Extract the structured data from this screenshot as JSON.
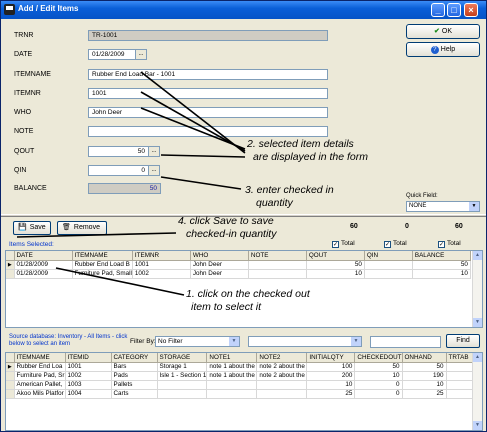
{
  "window": {
    "title": "Add / Edit Items"
  },
  "form": {
    "labels": {
      "trnr": "TRNR",
      "date": "DATE",
      "itemname": "ITEMNAME",
      "itemnr": "ITEMNR",
      "who": "WHO",
      "note": "NOTE",
      "qout": "QOUT",
      "qin": "QIN",
      "balance": "BALANCE"
    },
    "values": {
      "trnr": "TR-1001",
      "date": "01/28/2009",
      "itemname": "Rubber End Load Bar - 1001",
      "itemnr": "1001",
      "who": "John Deer",
      "note": "",
      "qout": "50",
      "qin": "0",
      "balance": "50"
    },
    "ellipsis": "..."
  },
  "buttons": {
    "ok": "OK",
    "help": "Help",
    "save": "Save",
    "remove": "Remove",
    "find": "Find"
  },
  "quick_field": {
    "label": "Quick Field:",
    "value": "NONE"
  },
  "totals": {
    "t1": "60",
    "t2": "0",
    "t3": "60",
    "check_label": "Total"
  },
  "items_selected_label": "Items Selected:",
  "top_grid": {
    "columns": [
      "DATE",
      "ITEMNAME",
      "ITEMNR",
      "WHO",
      "NOTE",
      "QOUT",
      "QIN",
      "BALANCE"
    ],
    "rows": [
      [
        "01/28/2009",
        "Rubber End Load B",
        "1001",
        "John Deer",
        "",
        "50",
        "",
        "50"
      ],
      [
        "01/28/2009",
        "Furniture Pad, Small",
        "1002",
        "John Deer",
        "",
        "10",
        "",
        "10"
      ]
    ]
  },
  "source": {
    "text": "Source database: Inventory - All Items - click below to select an item",
    "filter_label": "Filter By:",
    "filter_value": "No Filter",
    "filter2_value": ""
  },
  "bottom_grid": {
    "columns": [
      "ITEMNAME",
      "ITEMID",
      "CATEGORY",
      "STORAGE",
      "NOTE1",
      "NOTE2",
      "INITIALQTY",
      "CHECKEDOUT",
      "ONHAND",
      "TRTAB"
    ],
    "rows": [
      [
        "Rubber End Loa",
        "1001",
        "Bars",
        "Storage 1",
        "note 1 about the",
        "note 2 about the",
        "100",
        "50",
        "50",
        ""
      ],
      [
        "Furniture Pad, Sr",
        "1002",
        "Pads",
        "Isle 1 - Section 1",
        "note 1 about the",
        "note 2 about the",
        "200",
        "10",
        "190",
        ""
      ],
      [
        "American Pallet, ",
        "1003",
        "Pallets",
        "",
        "",
        "",
        "10",
        "0",
        "10",
        ""
      ],
      [
        "Akoo Mils Platfor",
        "1004",
        "Carts",
        "",
        "",
        "",
        "25",
        "0",
        "25",
        ""
      ]
    ]
  },
  "annotations": {
    "a1": "1. click on the checked out",
    "a1b": "item to select it",
    "a2": "2. selected item details",
    "a2b": "are displayed in the form",
    "a3": "3. enter checked in",
    "a3b": "quantity",
    "a4": "4. click Save to save",
    "a4b": "checked-in quantity"
  },
  "icons": {
    "app": "app-icon",
    "ok": "checkmark-icon",
    "help": "question-icon",
    "save": "save-icon",
    "remove": "trash-icon"
  },
  "colors": {
    "titlebar": "#0653c7",
    "link_text": "#0033cc",
    "window_bg": "#ece9d8"
  }
}
